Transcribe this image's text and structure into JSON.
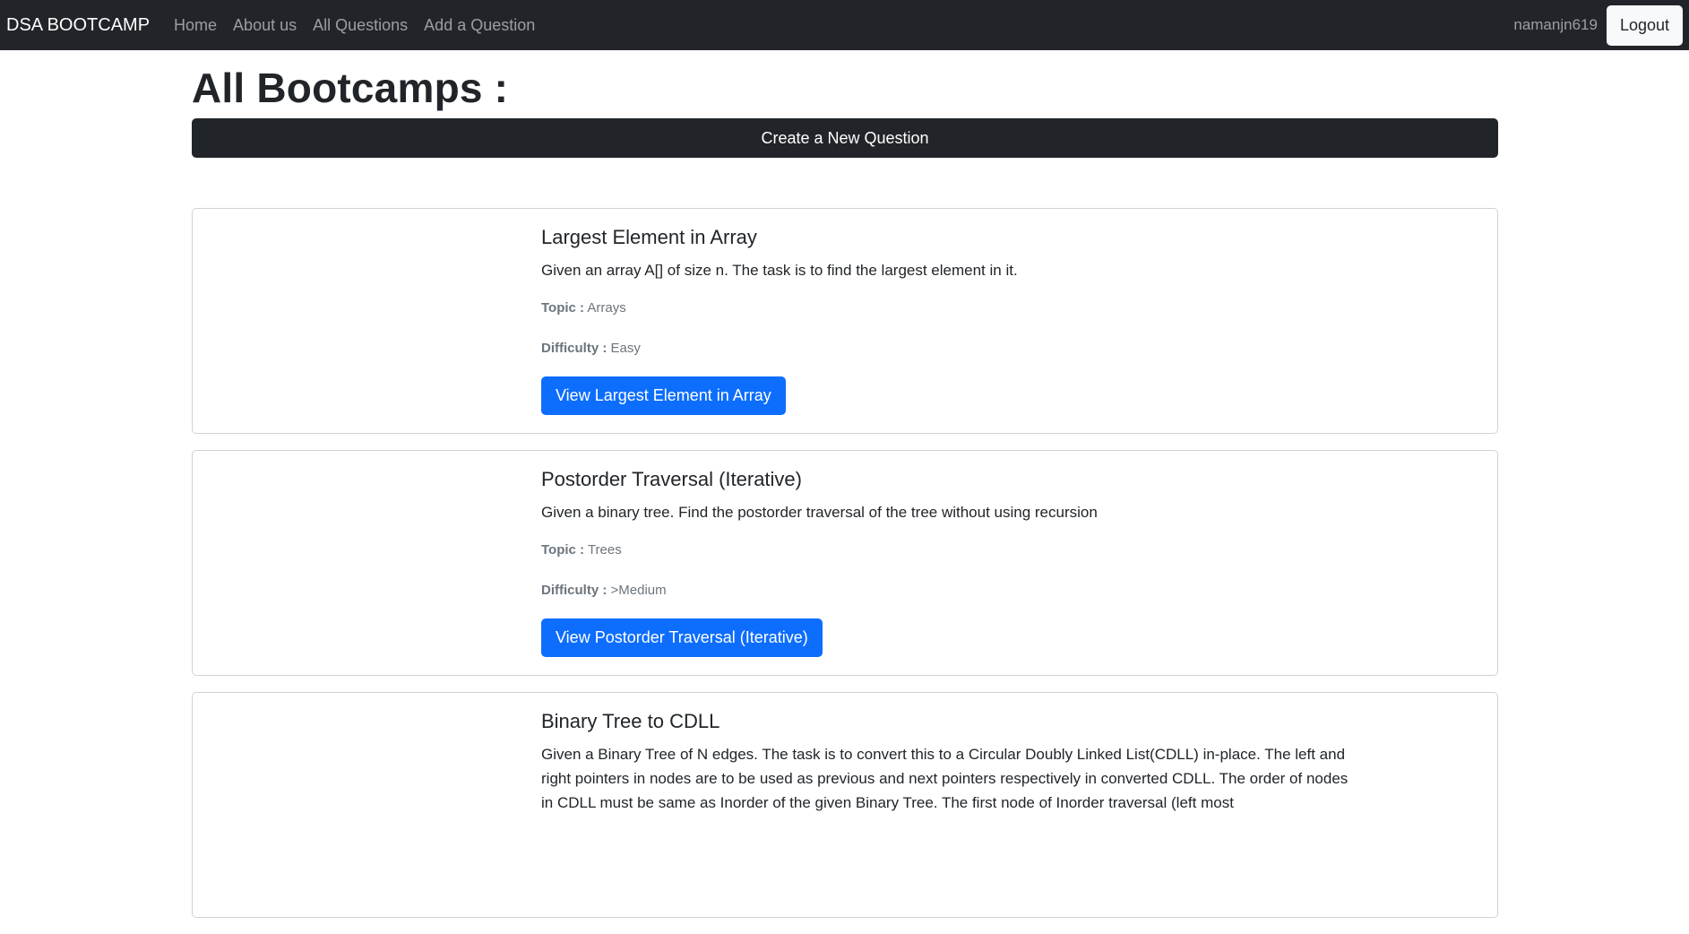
{
  "nav": {
    "brand": "DSA BOOTCAMP",
    "links": [
      "Home",
      "About us",
      "All Questions",
      "Add a Question"
    ],
    "username": "namanjn619",
    "logout_label": "Logout"
  },
  "page": {
    "title": "All Bootcamps :",
    "create_label": "Create a New Question"
  },
  "cards": [
    {
      "title": "Largest Element in Array",
      "description": "Given an array A[] of size n. The task is to find the largest element in it.",
      "topic_label": "Topic :",
      "topic": "Arrays",
      "difficulty_label": "Difficulty :",
      "difficulty": "Easy",
      "button": "View Largest Element in Array"
    },
    {
      "title": "Postorder Traversal (Iterative)",
      "description": "Given a binary tree. Find the postorder traversal of the tree without using recursion",
      "topic_label": "Topic :",
      "topic": "Trees",
      "difficulty_label": "Difficulty :",
      "difficulty": ">Medium",
      "button": "View Postorder Traversal (Iterative)"
    },
    {
      "title": "Binary Tree to CDLL",
      "description": "Given a Binary Tree of N edges. The task is to convert this to a Circular Doubly Linked List(CDLL) in-place. The left and right pointers in nodes are to be used as previous and next pointers respectively in converted CDLL. The order of nodes in CDLL must be same as Inorder of the given Binary Tree. The first node of Inorder traversal (left most"
    }
  ]
}
